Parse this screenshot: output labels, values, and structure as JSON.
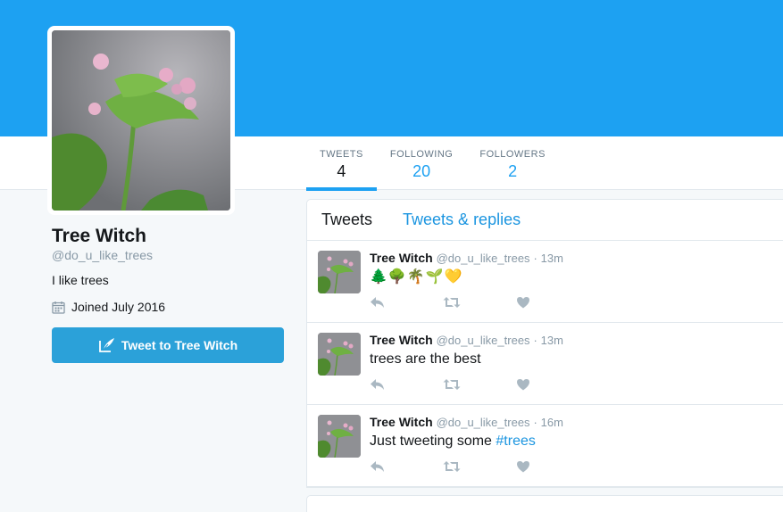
{
  "profile": {
    "name": "Tree Witch",
    "handle": "@do_u_like_trees",
    "bio": "I like trees",
    "joined": "Joined July 2016",
    "tweet_to_label": "Tweet to Tree Witch"
  },
  "stats": [
    {
      "label": "TWEETS",
      "value": "4"
    },
    {
      "label": "FOLLOWING",
      "value": "20"
    },
    {
      "label": "FOLLOWERS",
      "value": "2"
    }
  ],
  "timeline_tabs": [
    "Tweets",
    "Tweets & replies"
  ],
  "tweets": [
    {
      "name": "Tree Witch",
      "handle": "@do_u_like_trees",
      "sep": "·",
      "time": "13m",
      "text": "🌲🌳🌴🌱💛",
      "hashtag": ""
    },
    {
      "name": "Tree Witch",
      "handle": "@do_u_like_trees",
      "sep": "·",
      "time": "13m",
      "text": "trees are the best",
      "hashtag": ""
    },
    {
      "name": "Tree Witch",
      "handle": "@do_u_like_trees",
      "sep": "·",
      "time": "16m",
      "text": "Just tweeting some ",
      "hashtag": "#trees"
    }
  ],
  "icons": {
    "reply": "reply-icon",
    "retweet": "retweet-icon",
    "like": "heart-icon",
    "calendar": "calendar-icon",
    "compose": "compose-icon"
  },
  "colors": {
    "banner": "#1da1f2",
    "accent": "#1da1f2",
    "button": "#2ba1d9",
    "link": "#1b95e0",
    "action_icon": "#aab8c2"
  }
}
